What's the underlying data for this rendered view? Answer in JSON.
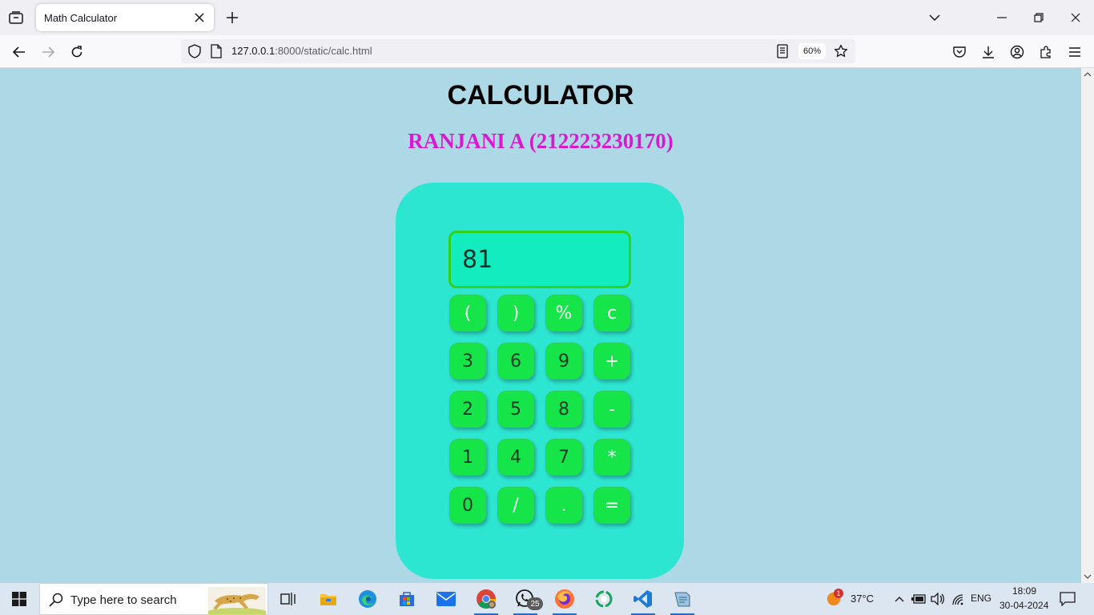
{
  "browser": {
    "tab_title": "Math Calculator",
    "url_host": "127.0.0.1",
    "url_rest": ":8000/static/calc.html",
    "zoom": "60%"
  },
  "page": {
    "heading": "CALCULATOR",
    "subheading": "RANJANI A (212223230170)",
    "colors": {
      "background": "#add8e6",
      "calc_body": "#2de6d2",
      "display": "#12ecbf",
      "keys": "#16e54a",
      "subheading": "#d61ad0"
    }
  },
  "calculator": {
    "display": "81",
    "keys": [
      [
        "(",
        ")",
        "%",
        "c"
      ],
      [
        "3",
        "6",
        "9",
        "+"
      ],
      [
        "2",
        "5",
        "8",
        "-"
      ],
      [
        "1",
        "4",
        "7",
        "*"
      ],
      [
        "0",
        "/",
        ".",
        "="
      ]
    ]
  },
  "taskbar": {
    "search_placeholder": "Type here to search",
    "whatsapp_badge": "25",
    "weather_badge": "1",
    "temperature": "37°C",
    "language": "ENG",
    "time": "18:09",
    "date": "30-04-2024",
    "icons": [
      "windows-start-icon",
      "task-view-icon",
      "file-explorer-icon",
      "edge-icon",
      "store-icon",
      "mail-icon",
      "chrome-icon",
      "whatsapp-icon",
      "firefox-icon",
      "refresh-app-icon",
      "vscode-icon",
      "notepad-icon"
    ]
  }
}
